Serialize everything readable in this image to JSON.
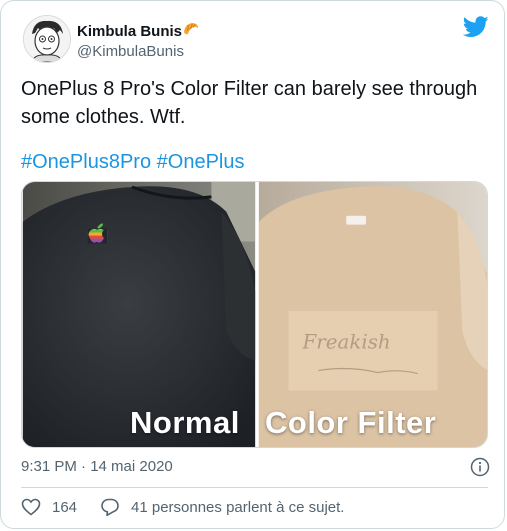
{
  "author": {
    "name": "Kimbula Bunis",
    "handle": "@KimbulaBunis",
    "name_emoji": "croissant-icon"
  },
  "tweet": {
    "text": "OnePlus 8 Pro's Color Filter can barely see through some clothes. Wtf.",
    "hashtags": [
      "#OnePlus8Pro",
      "#OnePlus"
    ]
  },
  "media": {
    "left_label": "Normal",
    "right_label": "Color Filter",
    "handwriting": "Freakish"
  },
  "timestamp": "9:31 PM · 14 mai 2020",
  "engagement": {
    "likes": "164",
    "replies_text": "41 personnes parlent à ce sujet."
  },
  "colors": {
    "link": "#1b95e0",
    "twitter_blue": "#1da1f2",
    "muted": "#536471",
    "border": "#cfd9de"
  },
  "icons": [
    "twitter-bird-icon",
    "info-icon",
    "heart-icon",
    "reply-bubble-icon",
    "croissant-icon"
  ]
}
